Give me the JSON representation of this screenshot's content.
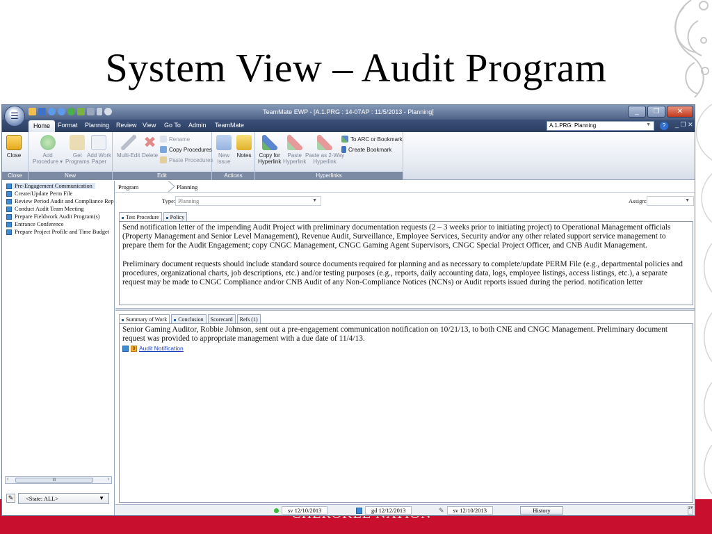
{
  "slide": {
    "title": "System View – Audit Program",
    "footer_text": "CHEROKEE NATION"
  },
  "window": {
    "title": "TeamMate EWP - [A.1.PRG : 14-07AP : 11/5/2013 - Planning]",
    "workpaper_select": "A.1.PRG: Planning"
  },
  "ribbon_tabs": [
    "Home",
    "Format",
    "Planning",
    "Review",
    "View",
    "Go To",
    "Admin",
    "TeamMate"
  ],
  "ribbon": {
    "close_group": {
      "label": "Close",
      "close": "Close"
    },
    "new_group": {
      "label": "New",
      "add_procedure": "Add\nProcedure ▾",
      "get_programs": "Get\nPrograms",
      "add_work_paper": "Add Work\nPaper"
    },
    "edit_group": {
      "label": "Edit",
      "multi_edit": "Multi-Edit",
      "delete": "Delete",
      "rename": "Rename",
      "copy_procedures": "Copy Procedures",
      "paste_procedures": "Paste Procedures"
    },
    "actions_group": {
      "label": "Actions",
      "new_issue": "New\nIssue",
      "notes": "Notes"
    },
    "hyperlinks_group": {
      "label": "Hyperlinks",
      "copy_for_hyperlink": "Copy for\nHyperlink",
      "paste_hyperlink": "Paste\nHyperlink",
      "paste_as_2way": "Paste as 2-Way\nHyperlink",
      "to_arc": "To ARC or Bookmark",
      "create_bookmark": "Create Bookmark"
    }
  },
  "nav": {
    "items": [
      "Pre-Engagement Communication",
      "Create/Update Perm File",
      "Review Period Audit and Compliance Rep",
      "Conduct Audit Team Meeting",
      "Prepare Fieldwork Audit Program(s)",
      "Entrance Conference",
      "Prepare Project Profile and Time Budget"
    ],
    "state_filter": "<State: ALL>",
    "scroll_thumb": "III"
  },
  "main": {
    "breadcrumb": [
      "Program",
      "Planning"
    ],
    "type_label": "Type:",
    "type_value": "Planning",
    "assign_label": "Assign:",
    "procedure_tabs": [
      "Test Procedure",
      "Policy"
    ],
    "procedure_text": [
      "Send notification letter of the impending Audit Project with preliminary documentation requests (2 – 3 weeks prior to initiating project) to Operational Management officials (Property Management and Senior Level Management), Revenue Audit, Surveillance, Employee Services, Security and/or any other related support service management to prepare them for the Audit Engagement; copy CNGC Management, CNGC Gaming Agent Supervisors, CNGC Special Project Officer, and CNB Audit Management.",
      "Preliminary document requests should include standard source documents required for planning and as necessary to complete/update PERM File (e.g., departmental policies and procedures, organizational charts, job descriptions, etc.) and/or testing purposes (e.g., reports, daily accounting data, logs, employee listings, access listings, etc.), a separate request may be made to CNGC Compliance and/or CNB Audit of any Non-Compliance Notices (NCNs) or Audit reports issued during the period.  notification letter"
    ],
    "summary_tabs": [
      "Summary of Work",
      "Conclusion",
      "Scorecard",
      "Refs (1)"
    ],
    "summary_text": "Senior Gaming Auditor, Robbie Johnson, sent out a pre-engagement communication notification on 10/21/13, to both CNE and CNGC Management. Preliminary document request was provided to appropriate management with a due date of 11/4/13.",
    "attachment_badge": "0",
    "attachment_link": "Audit Notification"
  },
  "status": {
    "prepared": "sv 12/10/2013",
    "detailed": "gd 12/12/2013",
    "reviewed": "sv 12/10/2013",
    "history": "History"
  }
}
